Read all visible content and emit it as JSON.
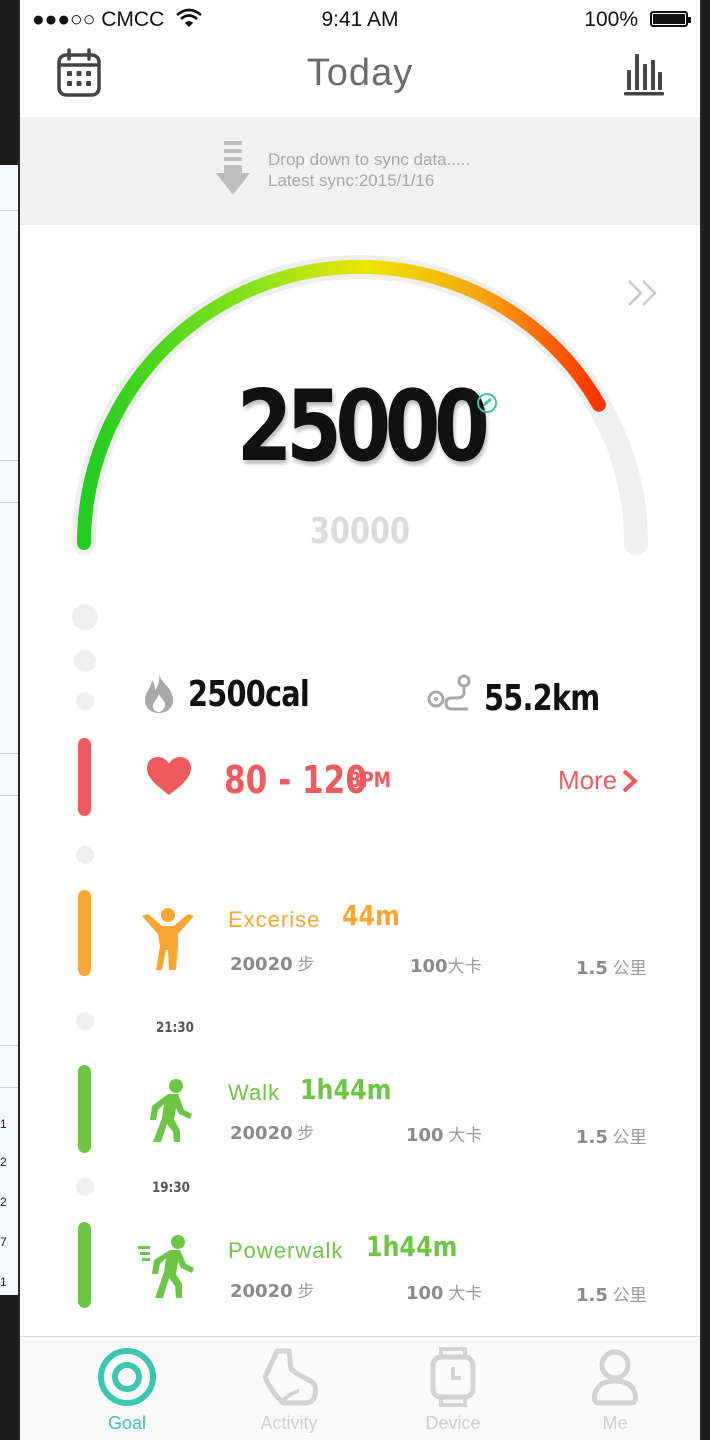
{
  "background_window": {
    "row_numbers": [
      "1",
      "2",
      "2",
      "7",
      "1"
    ]
  },
  "status_bar": {
    "carrier": "●●●○○ CMCC",
    "time": "9:41 AM",
    "battery": "100%"
  },
  "nav": {
    "title": "Today",
    "calendar_icon": "calendar-icon",
    "stats_icon": "bar-chart-icon"
  },
  "sync": {
    "line1": "Drop down to sync data.....",
    "line2": "Latest sync:2015/1/16"
  },
  "gauge": {
    "steps": "25000",
    "goal": "30000",
    "progress": 0.833,
    "colors": [
      "#22cc22",
      "#e6e600",
      "#ff3300"
    ]
  },
  "summary": {
    "calories": "2500cal",
    "distance": "55.2km"
  },
  "heart_rate": {
    "range": "80 - 120",
    "unit": "BPM",
    "more": "More",
    "color": "#ef5a5f"
  },
  "activities": [
    {
      "name": "Excerise",
      "duration": "44m",
      "steps": "20020",
      "steps_unit": "步",
      "calories": "100",
      "calories_unit": "大卡",
      "distance": "1.5",
      "distance_unit": "公里",
      "color": "#f7a631"
    },
    {
      "time": "21:30",
      "name": "Walk",
      "duration": "1h44m",
      "steps": "20020",
      "steps_unit": "步",
      "calories": "100",
      "calories_unit": "大卡",
      "distance": "1.5",
      "distance_unit": "公里",
      "color": "#6cc644"
    },
    {
      "time": "19:30",
      "name": "Powerwalk",
      "duration": "1h44m",
      "steps": "20020",
      "steps_unit": "步",
      "calories": "100",
      "calories_unit": "大卡",
      "distance": "1.5",
      "distance_unit": "公里",
      "color": "#6cc644"
    }
  ],
  "tabs": [
    {
      "label": "Goal",
      "icon": "target-icon",
      "active": true
    },
    {
      "label": "Activity",
      "icon": "shoe-icon",
      "active": false
    },
    {
      "label": "Device",
      "icon": "watch-icon",
      "active": false
    },
    {
      "label": "Me",
      "icon": "person-icon",
      "active": false
    }
  ],
  "accent_color": "#3cc5b0"
}
